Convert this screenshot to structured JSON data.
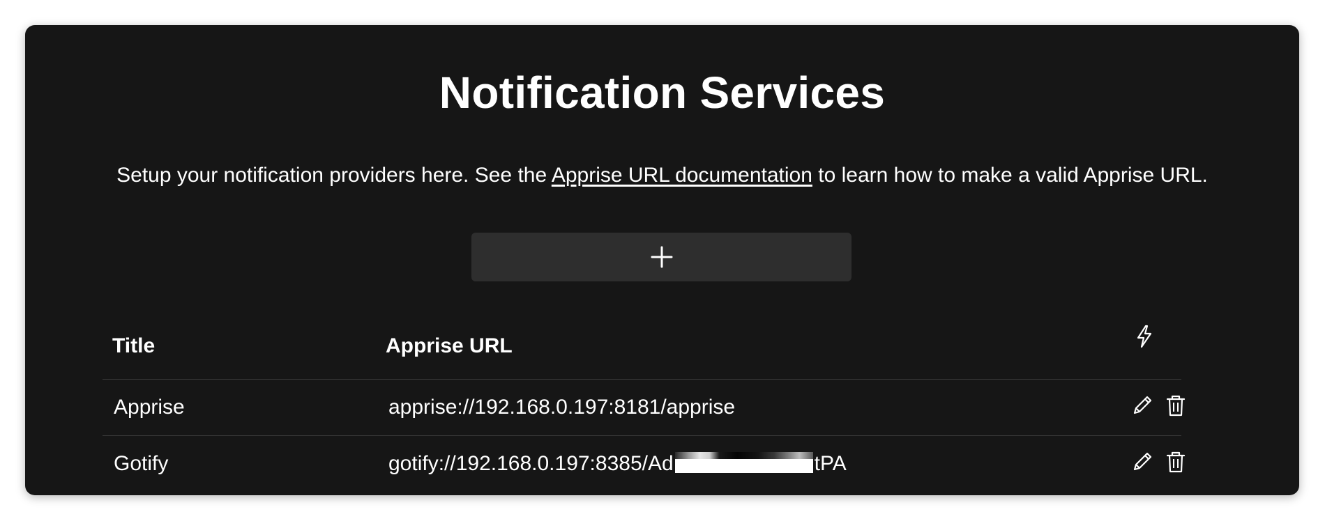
{
  "page": {
    "title": "Notification Services",
    "intro_before": "Setup your notification providers here. See the ",
    "intro_link": "Apprise URL documentation",
    "intro_after": " to learn how to make a valid Apprise URL."
  },
  "add_button": {
    "icon": "plus-icon"
  },
  "table": {
    "headers": {
      "title": "Title",
      "url": "Apprise URL",
      "test_icon": "lightning-icon"
    },
    "rows": [
      {
        "title": "Apprise",
        "url_prefix": "apprise://192.168.0.197:8181/apprise",
        "url_suffix": "",
        "redacted": false
      },
      {
        "title": "Gotify",
        "url_prefix": "gotify://192.168.0.197:8385/Ad",
        "url_suffix": "tPA",
        "redacted": true
      }
    ],
    "row_actions": [
      "pencil-icon",
      "trash-icon"
    ]
  },
  "colors": {
    "card_background": "#161616",
    "button_background": "#2e2e2e",
    "text": "#ffffff",
    "divider": "#3a3a3a"
  }
}
